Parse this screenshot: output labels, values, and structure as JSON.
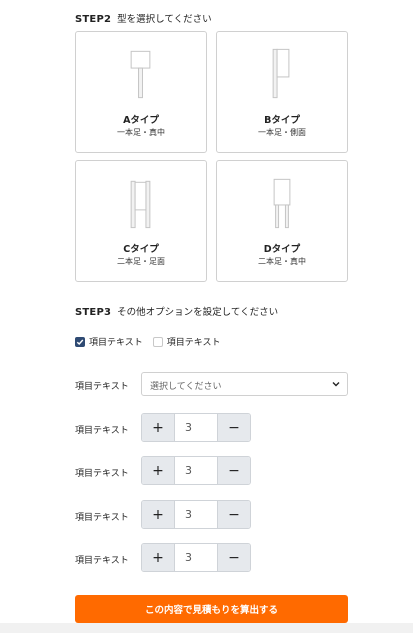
{
  "step2": {
    "num": "STEP2",
    "text": "型を選択してください"
  },
  "types": [
    {
      "name": "Aタイプ",
      "desc": "一本足・真中",
      "icon": "sign-stand-type-a"
    },
    {
      "name": "Bタイプ",
      "desc": "一本足・側面",
      "icon": "sign-stand-type-b"
    },
    {
      "name": "Cタイプ",
      "desc": "二本足・足面",
      "icon": "sign-stand-type-c"
    },
    {
      "name": "Dタイプ",
      "desc": "二本足・真中",
      "icon": "sign-stand-type-d"
    }
  ],
  "step3": {
    "num": "STEP3",
    "text": "その他オプションを設定してください"
  },
  "checkboxes": [
    {
      "label": "項目テキスト",
      "checked": true
    },
    {
      "label": "項目テキスト",
      "checked": false
    }
  ],
  "select": {
    "label": "項目テキスト",
    "placeholder": "選択してください"
  },
  "steppers": [
    {
      "label": "項目テキスト",
      "value": "3"
    },
    {
      "label": "項目テキスト",
      "value": "3"
    },
    {
      "label": "項目テキスト",
      "value": "3"
    },
    {
      "label": "項目テキスト",
      "value": "3"
    }
  ],
  "stepper_plus": "+",
  "stepper_minus": "−",
  "submit": {
    "label": "この内容で見積もりを算出する"
  },
  "colors": {
    "accent": "#ff6a00",
    "checkbox": "#2f4a73",
    "stepper_btn": "#e6e9ed"
  }
}
